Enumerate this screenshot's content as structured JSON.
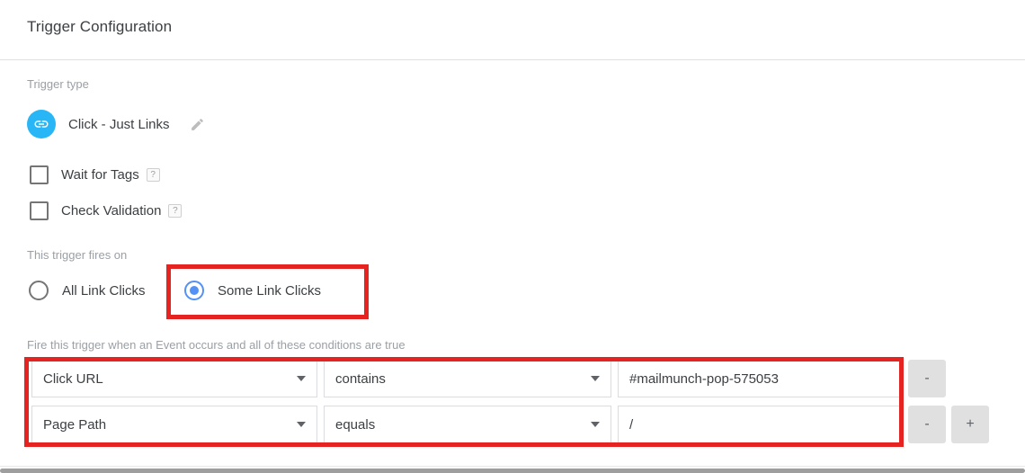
{
  "header": {
    "title": "Trigger Configuration"
  },
  "trigger_type": {
    "label": "Trigger type",
    "name": "Click - Just Links",
    "badge_icon": "link-icon",
    "badge_color": "#29b6f6",
    "edit_icon": "pencil-icon"
  },
  "options": {
    "checkboxes": [
      {
        "label": "Wait for Tags",
        "checked": false,
        "help": "?"
      },
      {
        "label": "Check Validation",
        "checked": false,
        "help": "?"
      }
    ]
  },
  "fires_on": {
    "label": "This trigger fires on",
    "options": [
      {
        "label": "All Link Clicks",
        "selected": false
      },
      {
        "label": "Some Link Clicks",
        "selected": true
      }
    ],
    "selected_value": "Some Link Clicks",
    "highlight_color": "#e52421"
  },
  "conditions": {
    "label": "Fire this trigger when an Event occurs and all of these conditions are true",
    "highlight_color": "#e52421",
    "rows": [
      {
        "variable": "Click URL",
        "operator": "contains",
        "value": "#mailmunch-pop-575053",
        "remove_label": "-",
        "add_label": null
      },
      {
        "variable": "Page Path",
        "operator": "equals",
        "value": "/",
        "remove_label": "-",
        "add_label": "+"
      }
    ]
  }
}
